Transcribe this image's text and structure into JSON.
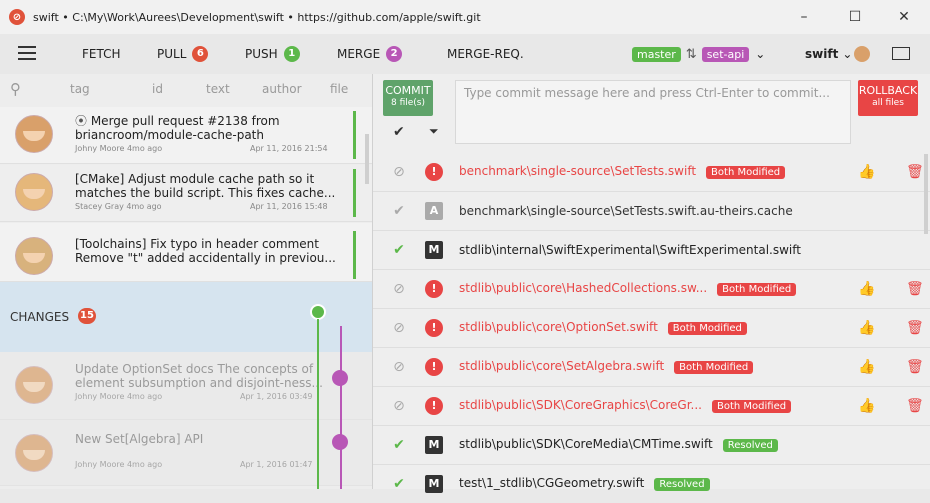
{
  "window": {
    "title": "swift  •  C:\\My\\Work\\Aurees\\Development\\swift  •  https://github.com/apple/swift.git",
    "app_icon": "app-logo-icon",
    "minimize": "–",
    "maximize": "☐",
    "close": "✕"
  },
  "toolbar": {
    "fetch": "FETCH",
    "pull": "PULL",
    "pull_count": "6",
    "push": "PUSH",
    "push_count": "1",
    "merge": "MERGE",
    "merge_count": "2",
    "merge_req": "MERGE-REQ.",
    "branch_current": "master",
    "branch_target": "set-api",
    "repo": "swift",
    "colors": {
      "pull": "#e0523a",
      "push": "#5cb84a",
      "merge": "#b857b6"
    }
  },
  "filters": [
    "tag",
    "id",
    "text",
    "author",
    "file"
  ],
  "commits": [
    {
      "message": "Merge pull request #2138 from briancroom/module-cache-path",
      "author": "Johny Moore 4mo ago",
      "date": "Apr 11, 2016  21:54"
    },
    {
      "message": "[CMake] Adjust module cache path so it matches the build script. This fixes cache...",
      "author": "Stacey Gray 4mo ago",
      "date": "Apr 11, 2016  15:48"
    },
    {
      "message": "[Toolchains] Fix typo in header comment Remove \"t\" added accidentally in previou...",
      "author": "",
      "date": ""
    }
  ],
  "changes": {
    "label": "CHANGES",
    "count": "15"
  },
  "local_commits": [
    {
      "message": "Update OptionSet docs The concepts of element subsumption and disjoint-ness...",
      "author": "Johny Moore 4mo ago",
      "date": "Apr 1, 2016  03:49"
    },
    {
      "message": "New Set[Algebra] API",
      "author": "Johny Moore 4mo ago",
      "date": "Apr 1, 2016  01:47"
    }
  ],
  "commit_panel": {
    "commit_label": "COMMIT",
    "commit_sub": "8 file(s)",
    "placeholder": "Type commit message here and press Ctrl-Enter to commit...",
    "rollback_label": "ROLLBACK",
    "rollback_sub": "all files"
  },
  "files": [
    {
      "path": "benchmark\\single-source\\SetTests.swift",
      "state": "Both Modified",
      "type": "conflict"
    },
    {
      "path": "benchmark\\single-source\\SetTests.swift.au-theirs.cache",
      "state": "",
      "type": "added"
    },
    {
      "path": "stdlib\\internal\\SwiftExperimental\\SwiftExperimental.swift",
      "state": "",
      "type": "modified"
    },
    {
      "path": "stdlib\\public\\core\\HashedCollections.sw...",
      "state": "Both Modified",
      "type": "conflict"
    },
    {
      "path": "stdlib\\public\\core\\OptionSet.swift",
      "state": "Both Modified",
      "type": "conflict"
    },
    {
      "path": "stdlib\\public\\core\\SetAlgebra.swift",
      "state": "Both Modified",
      "type": "conflict"
    },
    {
      "path": "stdlib\\public\\SDK\\CoreGraphics\\CoreGr...",
      "state": "Both Modified",
      "type": "conflict"
    },
    {
      "path": "stdlib\\public\\SDK\\CoreMedia\\CMTime.swift",
      "state": "Resolved",
      "type": "modified"
    },
    {
      "path": "test\\1_stdlib\\CGGeometry.swift",
      "state": "Resolved",
      "type": "modified"
    }
  ]
}
